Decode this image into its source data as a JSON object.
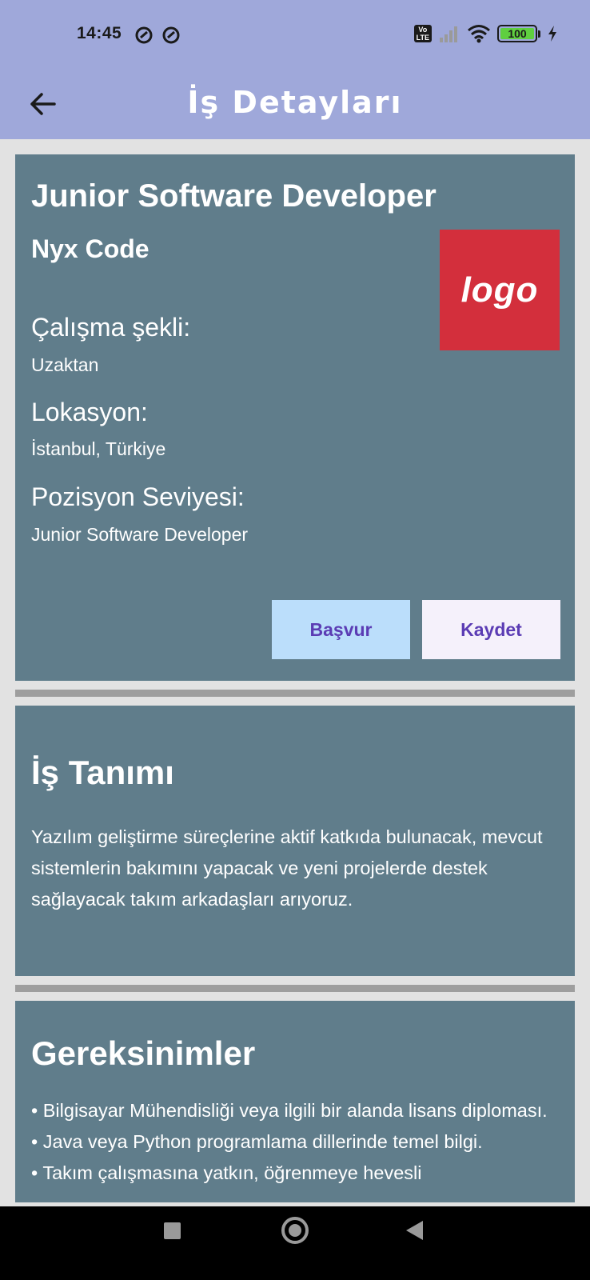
{
  "status_bar": {
    "time": "14:45",
    "volte": "Vo\nLTE",
    "battery": "100",
    "icons": [
      "notification-icon",
      "notification-icon",
      "signal-icon",
      "wifi-icon",
      "battery-icon",
      "charging-icon"
    ]
  },
  "app_bar": {
    "title": "İş Detayları",
    "back_icon": "arrow-left-icon"
  },
  "job": {
    "title": "Junior Software Developer",
    "company": "Nyx Code",
    "logo_text": "logo",
    "logo_color": "#d32f3c",
    "fields": [
      {
        "label": "Çalışma şekli:",
        "value": "Uzaktan"
      },
      {
        "label": "Lokasyon:",
        "value": "İstanbul, Türkiye"
      },
      {
        "label": "Pozisyon Seviyesi:",
        "value": "Junior Software Developer"
      }
    ],
    "apply_label": "Başvur",
    "save_label": "Kaydet"
  },
  "description": {
    "title": "İş Tanımı",
    "body": "Yazılım geliştirme süreçlerine aktif katkıda bulunacak, mevcut sistemlerin bakımını yapacak ve yeni projelerde destek sağlayacak takım arkadaşları arıyoruz."
  },
  "requirements": {
    "title": "Gereksinimler",
    "items": [
      "• Bilgisayar Mühendisliği veya ilgili bir alanda lisans diploması.",
      "• Java veya Python programlama dillerinde temel bilgi.",
      "• Takım çalışmasına yatkın, öğrenmeye hevesli"
    ]
  },
  "colors": {
    "app_bar": "#9fa8da",
    "card": "#607d8b",
    "apply_button": "#bbdefb",
    "save_button": "#f5f1fb",
    "button_text": "#5b3cb4"
  },
  "nav_bar": {
    "icons": [
      "recents-square-icon",
      "home-circle-icon",
      "back-triangle-icon"
    ]
  }
}
